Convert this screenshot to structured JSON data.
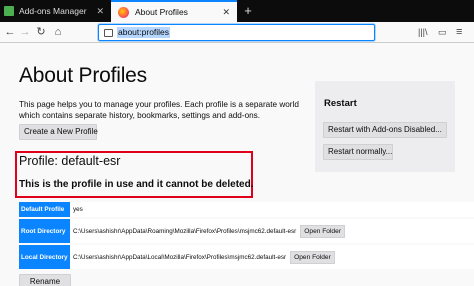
{
  "tabs": [
    {
      "label": "Add-ons Manager",
      "active": false
    },
    {
      "label": "About Profiles",
      "active": true
    }
  ],
  "new_tab_label": "+",
  "navbar": {
    "back_icon": "back-arrow-icon",
    "forward_icon": "forward-arrow-icon",
    "reload_icon": "reload-icon",
    "home_icon": "home-icon",
    "url": "about:profiles",
    "library_icon": "library-icon",
    "sidebar_icon": "sidebar-icon",
    "menu_icon": "hamburger-menu-icon"
  },
  "page": {
    "title": "About Profiles",
    "intro": "This page helps you to manage your profiles. Each profile is a separate world which contains separate history, bookmarks, settings and add-ons.",
    "create_button": "Create a New Profile"
  },
  "restart": {
    "title": "Restart",
    "restart_addons_disabled": "Restart with Add-ons Disabled...",
    "restart_normally": "Restart normally..."
  },
  "profile": {
    "name": "Profile: default-esr",
    "warning": "This is the profile in use and it cannot be deleted.",
    "rows": [
      {
        "label": "Default Profile",
        "value": "yes",
        "button": ""
      },
      {
        "label": "Root Directory",
        "value": "C:\\Users\\ashishr\\AppData\\Roaming\\Mozilla\\Firefox\\Profiles\\msjmc62.default-esr",
        "button": "Open Folder"
      },
      {
        "label": "Local Directory",
        "value": "C:\\Users\\ashishr\\AppData\\Local\\Mozilla\\Firefox\\Profiles\\msjmc62.default-esr",
        "button": "Open Folder"
      }
    ],
    "rename_button": "Rename"
  },
  "colors": {
    "accent": "#0a84ff",
    "highlight_border": "#e0001b",
    "tabstrip": "#0c0c0d"
  }
}
